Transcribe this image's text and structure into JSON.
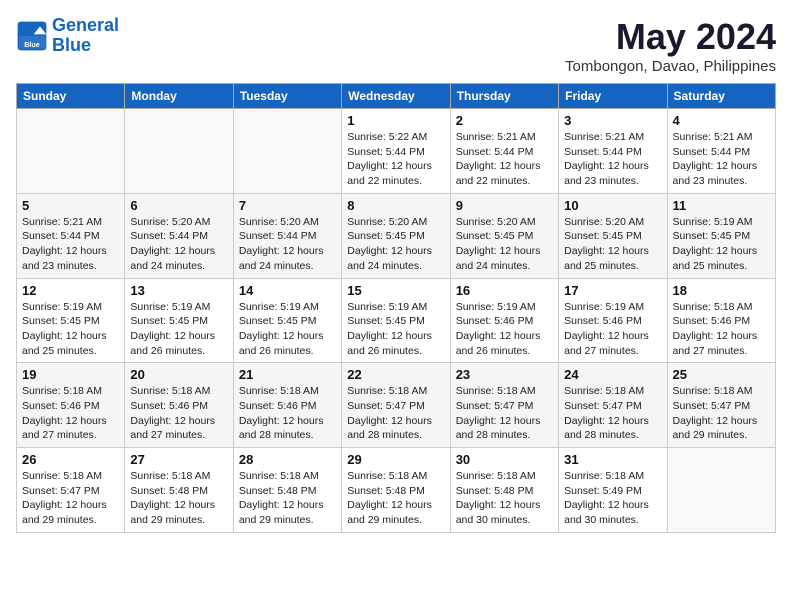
{
  "header": {
    "logo_line1": "General",
    "logo_line2": "Blue",
    "month": "May 2024",
    "location": "Tombongon, Davao, Philippines"
  },
  "weekdays": [
    "Sunday",
    "Monday",
    "Tuesday",
    "Wednesday",
    "Thursday",
    "Friday",
    "Saturday"
  ],
  "weeks": [
    [
      {
        "day": "",
        "info": ""
      },
      {
        "day": "",
        "info": ""
      },
      {
        "day": "",
        "info": ""
      },
      {
        "day": "1",
        "info": "Sunrise: 5:22 AM\nSunset: 5:44 PM\nDaylight: 12 hours\nand 22 minutes."
      },
      {
        "day": "2",
        "info": "Sunrise: 5:21 AM\nSunset: 5:44 PM\nDaylight: 12 hours\nand 22 minutes."
      },
      {
        "day": "3",
        "info": "Sunrise: 5:21 AM\nSunset: 5:44 PM\nDaylight: 12 hours\nand 23 minutes."
      },
      {
        "day": "4",
        "info": "Sunrise: 5:21 AM\nSunset: 5:44 PM\nDaylight: 12 hours\nand 23 minutes."
      }
    ],
    [
      {
        "day": "5",
        "info": "Sunrise: 5:21 AM\nSunset: 5:44 PM\nDaylight: 12 hours\nand 23 minutes."
      },
      {
        "day": "6",
        "info": "Sunrise: 5:20 AM\nSunset: 5:44 PM\nDaylight: 12 hours\nand 24 minutes."
      },
      {
        "day": "7",
        "info": "Sunrise: 5:20 AM\nSunset: 5:44 PM\nDaylight: 12 hours\nand 24 minutes."
      },
      {
        "day": "8",
        "info": "Sunrise: 5:20 AM\nSunset: 5:45 PM\nDaylight: 12 hours\nand 24 minutes."
      },
      {
        "day": "9",
        "info": "Sunrise: 5:20 AM\nSunset: 5:45 PM\nDaylight: 12 hours\nand 24 minutes."
      },
      {
        "day": "10",
        "info": "Sunrise: 5:20 AM\nSunset: 5:45 PM\nDaylight: 12 hours\nand 25 minutes."
      },
      {
        "day": "11",
        "info": "Sunrise: 5:19 AM\nSunset: 5:45 PM\nDaylight: 12 hours\nand 25 minutes."
      }
    ],
    [
      {
        "day": "12",
        "info": "Sunrise: 5:19 AM\nSunset: 5:45 PM\nDaylight: 12 hours\nand 25 minutes."
      },
      {
        "day": "13",
        "info": "Sunrise: 5:19 AM\nSunset: 5:45 PM\nDaylight: 12 hours\nand 26 minutes."
      },
      {
        "day": "14",
        "info": "Sunrise: 5:19 AM\nSunset: 5:45 PM\nDaylight: 12 hours\nand 26 minutes."
      },
      {
        "day": "15",
        "info": "Sunrise: 5:19 AM\nSunset: 5:45 PM\nDaylight: 12 hours\nand 26 minutes."
      },
      {
        "day": "16",
        "info": "Sunrise: 5:19 AM\nSunset: 5:46 PM\nDaylight: 12 hours\nand 26 minutes."
      },
      {
        "day": "17",
        "info": "Sunrise: 5:19 AM\nSunset: 5:46 PM\nDaylight: 12 hours\nand 27 minutes."
      },
      {
        "day": "18",
        "info": "Sunrise: 5:18 AM\nSunset: 5:46 PM\nDaylight: 12 hours\nand 27 minutes."
      }
    ],
    [
      {
        "day": "19",
        "info": "Sunrise: 5:18 AM\nSunset: 5:46 PM\nDaylight: 12 hours\nand 27 minutes."
      },
      {
        "day": "20",
        "info": "Sunrise: 5:18 AM\nSunset: 5:46 PM\nDaylight: 12 hours\nand 27 minutes."
      },
      {
        "day": "21",
        "info": "Sunrise: 5:18 AM\nSunset: 5:46 PM\nDaylight: 12 hours\nand 28 minutes."
      },
      {
        "day": "22",
        "info": "Sunrise: 5:18 AM\nSunset: 5:47 PM\nDaylight: 12 hours\nand 28 minutes."
      },
      {
        "day": "23",
        "info": "Sunrise: 5:18 AM\nSunset: 5:47 PM\nDaylight: 12 hours\nand 28 minutes."
      },
      {
        "day": "24",
        "info": "Sunrise: 5:18 AM\nSunset: 5:47 PM\nDaylight: 12 hours\nand 28 minutes."
      },
      {
        "day": "25",
        "info": "Sunrise: 5:18 AM\nSunset: 5:47 PM\nDaylight: 12 hours\nand 29 minutes."
      }
    ],
    [
      {
        "day": "26",
        "info": "Sunrise: 5:18 AM\nSunset: 5:47 PM\nDaylight: 12 hours\nand 29 minutes."
      },
      {
        "day": "27",
        "info": "Sunrise: 5:18 AM\nSunset: 5:48 PM\nDaylight: 12 hours\nand 29 minutes."
      },
      {
        "day": "28",
        "info": "Sunrise: 5:18 AM\nSunset: 5:48 PM\nDaylight: 12 hours\nand 29 minutes."
      },
      {
        "day": "29",
        "info": "Sunrise: 5:18 AM\nSunset: 5:48 PM\nDaylight: 12 hours\nand 29 minutes."
      },
      {
        "day": "30",
        "info": "Sunrise: 5:18 AM\nSunset: 5:48 PM\nDaylight: 12 hours\nand 30 minutes."
      },
      {
        "day": "31",
        "info": "Sunrise: 5:18 AM\nSunset: 5:49 PM\nDaylight: 12 hours\nand 30 minutes."
      },
      {
        "day": "",
        "info": ""
      }
    ]
  ]
}
